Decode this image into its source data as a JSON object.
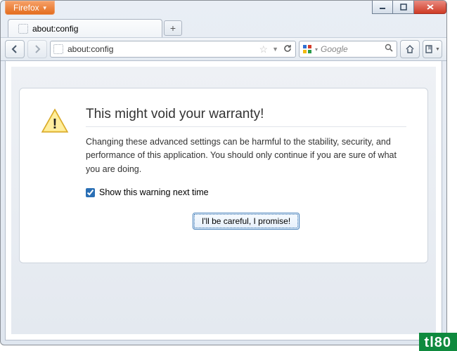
{
  "window": {
    "app_menu_label": "Firefox"
  },
  "tabs": {
    "active_title": "about:config"
  },
  "urlbar": {
    "value": "about:config"
  },
  "searchbar": {
    "placeholder": "Google"
  },
  "warning": {
    "title": "This might void your warranty!",
    "body": "Changing these advanced settings can be harmful to the stability, security, and performance of this application. You should only continue if you are sure of what you are doing.",
    "checkbox_label": "Show this warning next time",
    "checkbox_checked": true,
    "button_label": "I'll be careful, I promise!"
  },
  "watermark": "tl80"
}
